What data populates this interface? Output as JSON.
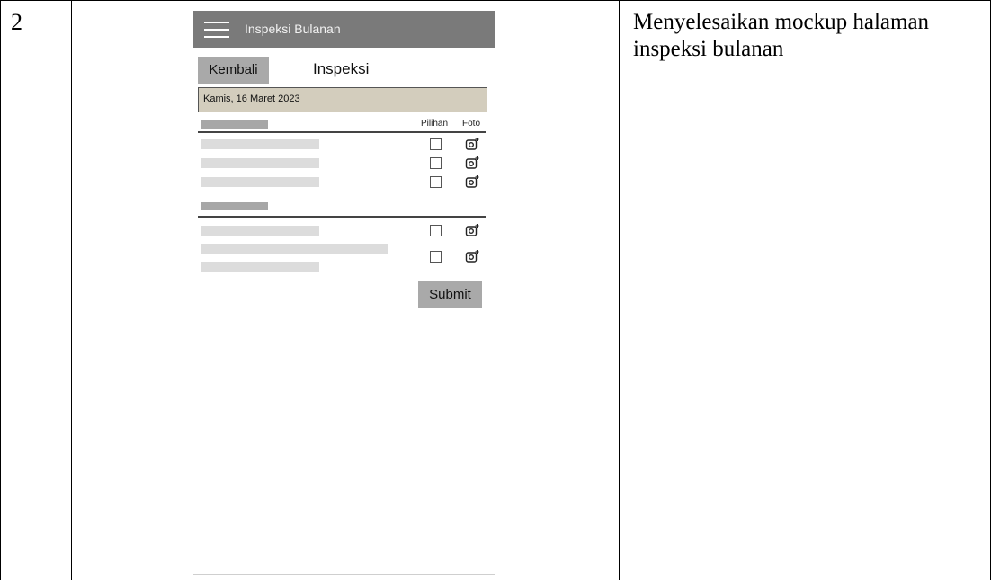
{
  "document": {
    "row_number": "2",
    "description": "Menyelesaikan mockup halaman inspeksi bulanan"
  },
  "mockup": {
    "appbar": {
      "title": "Inspeksi Bulanan",
      "menu_icon": "hamburger-menu-icon"
    },
    "back_label": "Kembali",
    "page_title": "Inspeksi",
    "date": "Kamis, 16 Maret 2023",
    "columns": {
      "choice": "Pilihan",
      "photo": "Foto"
    },
    "item_icon": "camera-add-icon",
    "submit_label": "Submit",
    "colors": {
      "appbar": "#7a7a7a",
      "date_bar": "#d3cdbd",
      "button": "#a9a9a9",
      "placeholder": "#dcdcdc"
    }
  }
}
